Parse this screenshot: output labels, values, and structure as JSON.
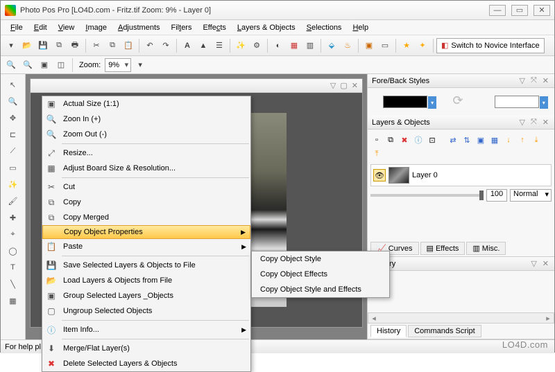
{
  "title": "Photo Pos Pro  [LO4D.com - Fritz.tif Zoom: 9% - Layer 0]",
  "menubar": [
    "File",
    "Edit",
    "View",
    "Image",
    "Adjustments",
    "Filters",
    "Effects",
    "Layers & Objects",
    "Selections",
    "Help"
  ],
  "novice_label": "Switch to Novice Interface",
  "zoom": {
    "label": "Zoom:",
    "value": "9%"
  },
  "panels": {
    "foreback": "Fore/Back Styles",
    "layers": "Layers & Objects",
    "history": "History"
  },
  "layer": {
    "name": "Layer 0",
    "opacity": "100",
    "blend": "Normal"
  },
  "tabs_mid": [
    "Curves",
    "Effects",
    "Misc."
  ],
  "tabs_hist": [
    "History",
    "Commands Script"
  ],
  "status": "For help pl",
  "watermark": "LO4D.com",
  "ctx": {
    "actual": "Actual Size (1:1)",
    "zoomin": "Zoon In (+)",
    "zoomout": "Zoom Out (-)",
    "resize": "Resize...",
    "adjust": "Adjust Board  Size & Resolution...",
    "cut": "Cut",
    "copy": "Copy",
    "copymerged": "Copy Merged",
    "copyprops": "Copy Object Properties",
    "paste": "Paste",
    "savelayers": "Save Selected Layers & Objects to File",
    "loadlayers": "Load Layers & Objects from File",
    "group": "Group Selected Layers _Objects",
    "ungroup": "Ungroup Selected Objects",
    "iteminfo": "Item Info...",
    "merge": "Merge/Flat Layer(s)",
    "delete": "Delete Selected Layers & Objects"
  },
  "submenu": {
    "style": "Copy Object Style",
    "effects": "Copy Object Effects",
    "both": "Copy Object Style and Effects"
  }
}
